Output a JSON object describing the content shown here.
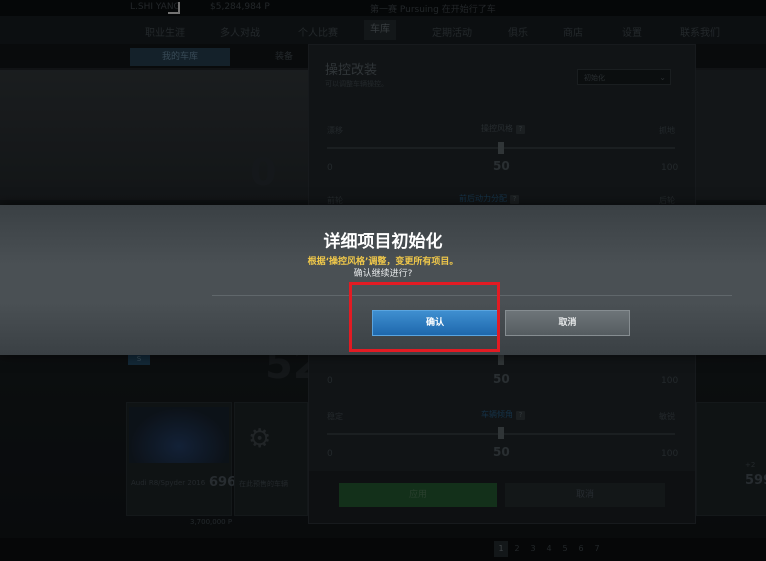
{
  "top": {
    "player": "L.SHI YANG",
    "money": "$5,284,984 P",
    "center": "第一赛 Pursuing 在开始行了车"
  },
  "nav": {
    "items": [
      {
        "label": "职业生涯"
      },
      {
        "label": "多人对战"
      },
      {
        "label": "个人比赛"
      },
      {
        "label": "车库"
      },
      {
        "label": "定期活动"
      },
      {
        "label": "俱乐"
      },
      {
        "label": "商店"
      },
      {
        "label": "设置"
      },
      {
        "label": "联系我们"
      }
    ]
  },
  "subtabs": [
    "我的车库",
    "装备"
  ],
  "tuning": {
    "title": "操控改装",
    "subtitle": "可以调整车辆操控。",
    "preset_value": "初始化",
    "rows": [
      {
        "left": "漂移",
        "center": "操控风格",
        "right": "抓地",
        "value": "50",
        "min": "0",
        "max": "100",
        "center_blue": false
      },
      {
        "left": "前轮",
        "center": "前后动力分配",
        "right": "后轮",
        "value": "",
        "min": "",
        "max": "",
        "center_blue": true
      },
      {
        "left": "",
        "center": "",
        "right": "",
        "value": "50",
        "min": "0",
        "max": "100",
        "center_blue": false
      },
      {
        "left": "稳定",
        "center": "车辆倾角",
        "right": "敏锐",
        "value": "50",
        "min": "0",
        "max": "100",
        "center_blue": true
      }
    ],
    "apply_label": "应用",
    "cancel_label": "取消"
  },
  "cards": {
    "left": {
      "name": "Audi R8/Spyder 2016",
      "rating": "696",
      "price": "3,700,000 P",
      "badge": "S"
    },
    "mid": {
      "name": "在此预售的车辆",
      "rating": ""
    },
    "right": {
      "rating": "599",
      "badge": "+2"
    }
  },
  "pager": {
    "pages": [
      "1",
      "2",
      "3",
      "4",
      "5",
      "6",
      "7"
    ],
    "current": "1"
  },
  "dialog": {
    "title": "详细项目初始化",
    "warning": "根据‘操控风格’调整，变更所有项目。",
    "question": "确认继续进行?",
    "ok_label": "确认",
    "cancel_label": "取消"
  },
  "colors": {
    "ok": "#2a7bc0",
    "warn": "#f0c84a",
    "highlight": "#e21b23",
    "apply": "#2a6b3a"
  }
}
